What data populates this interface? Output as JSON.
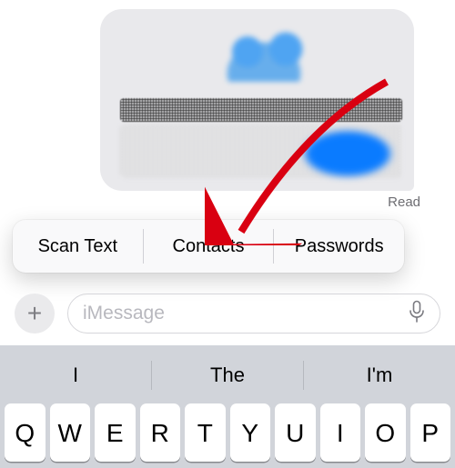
{
  "bubble": {
    "read_label": "Read"
  },
  "popover": {
    "items": [
      {
        "label": "Scan Text"
      },
      {
        "label": "Contacts"
      },
      {
        "label": "Passwords"
      }
    ]
  },
  "composer": {
    "placeholder": "iMessage",
    "plus_label": "+"
  },
  "keyboard": {
    "suggestions": [
      "I",
      "The",
      "I'm"
    ],
    "keys_row1": [
      "Q",
      "W",
      "E",
      "R",
      "T",
      "Y",
      "U",
      "I",
      "O",
      "P"
    ]
  }
}
